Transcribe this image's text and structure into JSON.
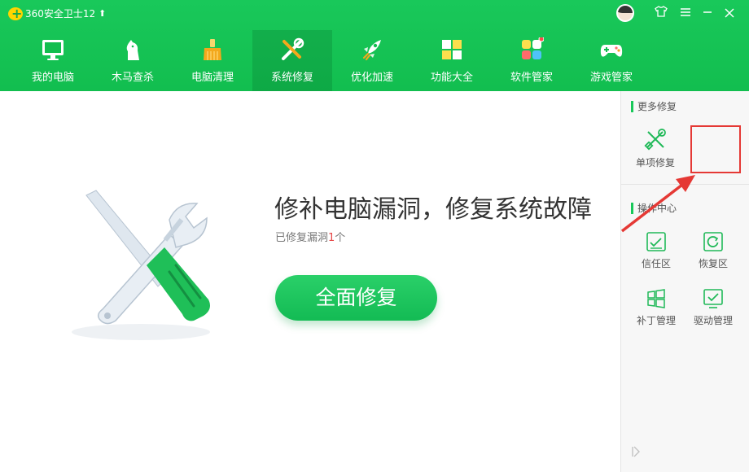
{
  "app": {
    "title": "360安全卫士12"
  },
  "nav": {
    "items": [
      {
        "label": "我的电脑",
        "icon": "monitor-icon"
      },
      {
        "label": "木马查杀",
        "icon": "horse-icon"
      },
      {
        "label": "电脑清理",
        "icon": "broom-icon"
      },
      {
        "label": "系统修复",
        "icon": "repair-tools-icon",
        "active": true
      },
      {
        "label": "优化加速",
        "icon": "rocket-icon"
      },
      {
        "label": "功能大全",
        "icon": "grid-icon"
      },
      {
        "label": "软件管家",
        "icon": "apps-icon"
      },
      {
        "label": "游戏管家",
        "icon": "gamepad-icon"
      }
    ]
  },
  "main": {
    "headline": "修补电脑漏洞，修复系统故障",
    "status_prefix": "已修复漏洞",
    "status_count": "1",
    "status_suffix": "个",
    "repair_button": "全面修复"
  },
  "sidebar": {
    "more_title": "更多修复",
    "single_repair": "单项修复",
    "ops_title": "操作中心",
    "tools": [
      "信任区",
      "恢复区",
      "补丁管理",
      "驱动管理"
    ]
  },
  "colors": {
    "brand_green": "#19c85a",
    "highlight_red": "#e53935"
  }
}
